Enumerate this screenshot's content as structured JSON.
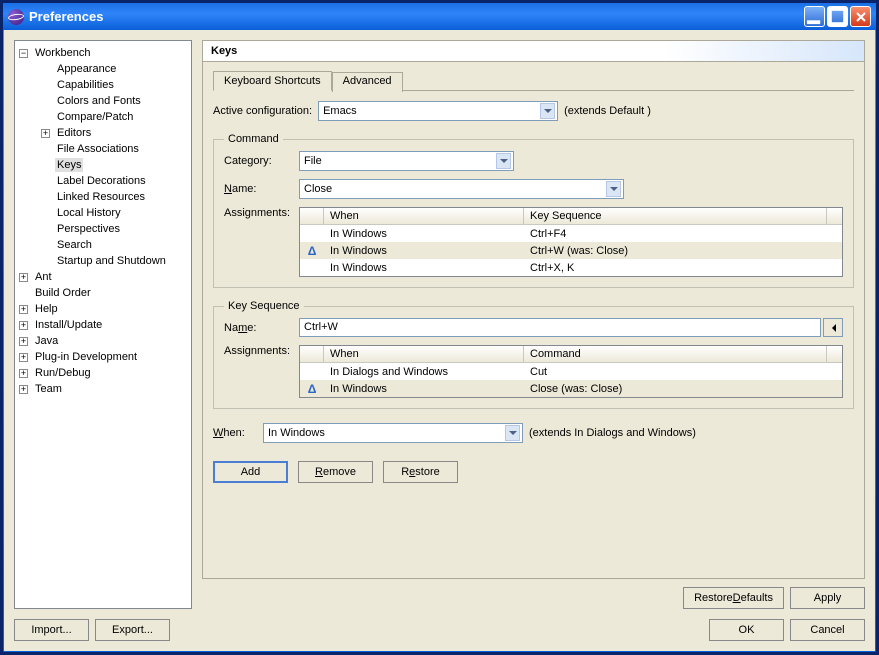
{
  "window": {
    "title": "Preferences"
  },
  "tree": [
    {
      "label": "Workbench",
      "depth": 0,
      "exp": "-"
    },
    {
      "label": "Appearance",
      "depth": 1,
      "exp": ""
    },
    {
      "label": "Capabilities",
      "depth": 1,
      "exp": ""
    },
    {
      "label": "Colors and Fonts",
      "depth": 1,
      "exp": ""
    },
    {
      "label": "Compare/Patch",
      "depth": 1,
      "exp": ""
    },
    {
      "label": "Editors",
      "depth": 1,
      "exp": "+"
    },
    {
      "label": "File Associations",
      "depth": 1,
      "exp": ""
    },
    {
      "label": "Keys",
      "depth": 1,
      "exp": "",
      "selected": true
    },
    {
      "label": "Label Decorations",
      "depth": 1,
      "exp": ""
    },
    {
      "label": "Linked Resources",
      "depth": 1,
      "exp": ""
    },
    {
      "label": "Local History",
      "depth": 1,
      "exp": ""
    },
    {
      "label": "Perspectives",
      "depth": 1,
      "exp": ""
    },
    {
      "label": "Search",
      "depth": 1,
      "exp": ""
    },
    {
      "label": "Startup and Shutdown",
      "depth": 1,
      "exp": ""
    },
    {
      "label": "Ant",
      "depth": 0,
      "exp": "+"
    },
    {
      "label": "Build Order",
      "depth": 0,
      "exp": ""
    },
    {
      "label": "Help",
      "depth": 0,
      "exp": "+"
    },
    {
      "label": "Install/Update",
      "depth": 0,
      "exp": "+"
    },
    {
      "label": "Java",
      "depth": 0,
      "exp": "+"
    },
    {
      "label": "Plug-in Development",
      "depth": 0,
      "exp": "+"
    },
    {
      "label": "Run/Debug",
      "depth": 0,
      "exp": "+"
    },
    {
      "label": "Team",
      "depth": 0,
      "exp": "+"
    }
  ],
  "page": {
    "title": "Keys",
    "tabs": [
      "Keyboard Shortcuts",
      "Advanced"
    ],
    "active_tab": 0,
    "active_config_label": "Active configuration:",
    "active_config_value": "Emacs",
    "active_config_hint": "(extends Default )",
    "command_group": {
      "legend": "Command",
      "category_label": "Category:",
      "category_value": "File",
      "name_label": "Name:",
      "name_value": "Close",
      "assignments_label": "Assignments:",
      "table": {
        "headers": [
          "When",
          "Key Sequence"
        ],
        "rows": [
          {
            "delta": false,
            "when": "In Windows",
            "key": "Ctrl+F4"
          },
          {
            "delta": true,
            "when": "In Windows",
            "key": "Ctrl+W (was: Close)"
          },
          {
            "delta": false,
            "when": "In Windows",
            "key": "Ctrl+X, K"
          }
        ]
      }
    },
    "keyseq_group": {
      "legend": "Key Sequence",
      "name_label": "Name:",
      "name_value": "Ctrl+W",
      "assignments_label": "Assignments:",
      "table": {
        "headers": [
          "When",
          "Command"
        ],
        "rows": [
          {
            "delta": false,
            "when": "In Dialogs and Windows",
            "cmd": "Cut"
          },
          {
            "delta": true,
            "when": "In Windows",
            "cmd": "Close (was: Close)"
          }
        ]
      }
    },
    "when_label": "When:",
    "when_value": "In Windows",
    "when_hint": "(extends In Dialogs and Windows)",
    "buttons": {
      "add": "Add",
      "remove": "Remove",
      "restore": "Restore"
    },
    "page_buttons": {
      "restore_defaults": "Restore Defaults",
      "apply": "Apply"
    }
  },
  "footer": {
    "import": "Import...",
    "export": "Export...",
    "ok": "OK",
    "cancel": "Cancel"
  }
}
